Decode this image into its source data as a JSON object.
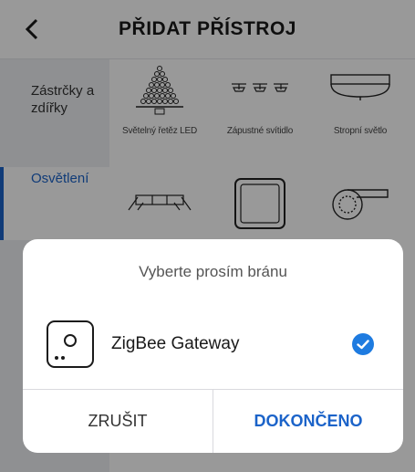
{
  "header": {
    "title": "PŘIDAT PŘÍSTROJ"
  },
  "sidebar": {
    "items": [
      {
        "label": "Zástrčky a zdířky"
      },
      {
        "label": "Osvětlení"
      }
    ]
  },
  "products": [
    {
      "label": "Světelný řetěz LED",
      "icon": "led-string-icon"
    },
    {
      "label": "Zápustné svítidlo",
      "icon": "recessed-light-icon"
    },
    {
      "label": "Stropní světlo",
      "icon": "ceiling-light-icon"
    },
    {
      "label": "",
      "icon": "light-strip-icon"
    },
    {
      "label": "",
      "icon": "panel-light-icon"
    },
    {
      "label": "",
      "icon": "ring-strip-icon"
    }
  ],
  "dialog": {
    "title": "Vyberte prosím bránu",
    "gateway": {
      "name": "ZigBee Gateway",
      "selected": true
    },
    "cancel_label": "ZRUŠIT",
    "done_label": "DOKONČENO"
  },
  "colors": {
    "accent": "#1b63c9",
    "check": "#1e7be0"
  }
}
